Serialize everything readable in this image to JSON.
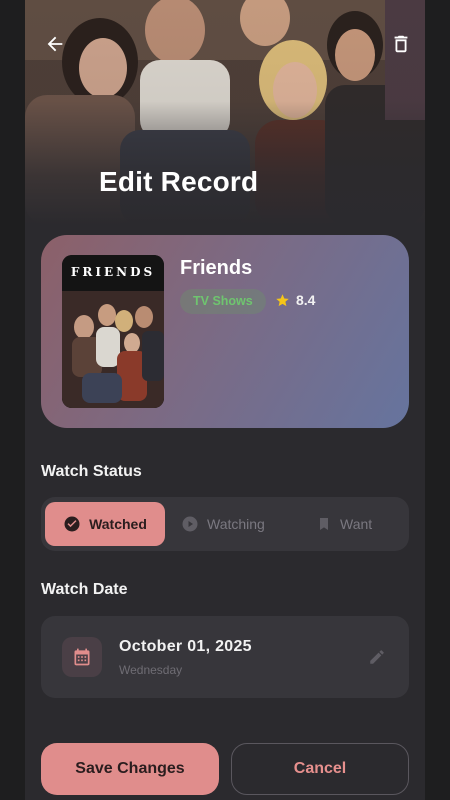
{
  "header": {
    "title": "Edit Record",
    "back_icon": "arrow-back-icon",
    "delete_icon": "trash-icon"
  },
  "record": {
    "poster_title": "FRIENDS",
    "name": "Friends",
    "genre": "TV Shows",
    "rating": "8.4"
  },
  "watch_status": {
    "label": "Watch Status",
    "options": [
      {
        "label": "Watched",
        "icon": "check-circle-icon",
        "selected": true
      },
      {
        "label": "Watching",
        "icon": "play-circle-icon",
        "selected": false
      },
      {
        "label": "Want",
        "icon": "bookmark-icon",
        "selected": false
      }
    ]
  },
  "watch_date": {
    "label": "Watch Date",
    "date": "October 01, 2025",
    "weekday": "Wednesday"
  },
  "actions": {
    "save_label": "Save Changes",
    "cancel_label": "Cancel"
  },
  "colors": {
    "accent": "#e08d8c",
    "background": "#2b2a2e",
    "surface": "#37363b",
    "genre_text": "#6fc56f",
    "star": "#f5c518"
  }
}
